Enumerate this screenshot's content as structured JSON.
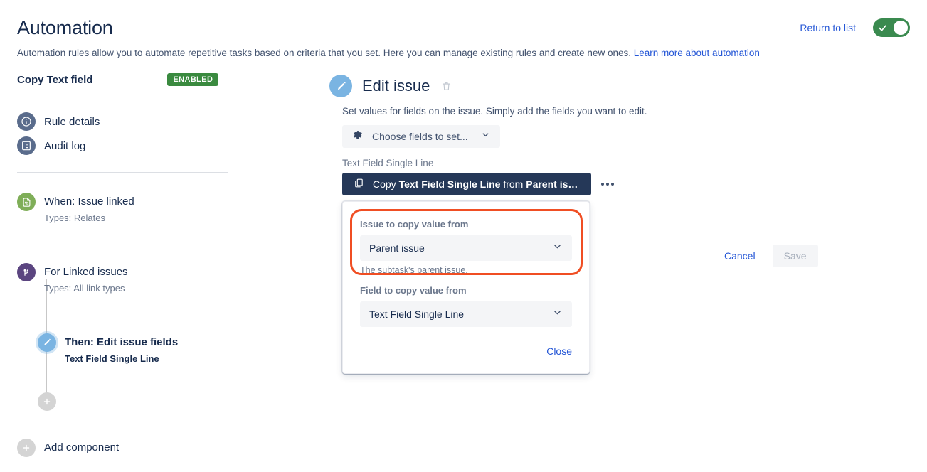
{
  "header": {
    "title": "Automation",
    "return_link": "Return to list",
    "toggle_state_icon": "check-icon",
    "toggle_color": "#3a8a4f",
    "description_prefix": "Automation rules allow you to automate repetitive tasks based on criteria that you set. Here you can manage existing rules and create new ones. ",
    "learn_more_link": "Learn more about automation"
  },
  "sidebar": {
    "rule_name": "Copy Text field",
    "status_badge": "ENABLED",
    "status_badge_color": "#3a8a3f",
    "nav_items": [
      {
        "label": "Rule details",
        "icon": "info-circle-icon"
      },
      {
        "label": "Audit log",
        "icon": "list-document-icon"
      }
    ],
    "tree": {
      "when": {
        "title": "When: Issue linked",
        "subtitle": "Types: Relates",
        "icon": "issue-linked-icon",
        "color": "#7fae58"
      },
      "for": {
        "title": "For Linked issues",
        "subtitle": "Types: All link types",
        "icon": "branch-icon",
        "color": "#5b4580"
      },
      "then": {
        "title": "Then: Edit issue fields",
        "subtitle": "Text Field Single Line",
        "icon": "pencil-icon",
        "color": "#7ab4e2"
      },
      "add_inner": {
        "icon": "plus-icon"
      },
      "add_component": {
        "label": "Add component",
        "icon": "plus-icon"
      }
    }
  },
  "main": {
    "icon": "pencil-icon",
    "title": "Edit issue",
    "delete_icon": "trash-icon",
    "description": "Set values for fields on the issue. Simply add the fields you want to edit.",
    "choose_fields": {
      "icon": "gear-icon",
      "label": "Choose fields to set...",
      "chevron": "chevron-down-icon"
    },
    "field_label": "Text Field Single Line",
    "copy_chip": {
      "icon": "copy-icon",
      "text_prefix": "Copy ",
      "text_bold_1": "Text Field Single Line",
      "text_mid": " from ",
      "text_bold_2": "Parent is…"
    },
    "more_menu": "more-options-icon"
  },
  "popup": {
    "highlighted": true,
    "highlight_color": "#f04e23",
    "issue_field": {
      "label": "Issue to copy value from",
      "value": "Parent issue",
      "help": "The subtask's parent issue.",
      "chevron": "chevron-down-icon"
    },
    "field_field": {
      "label": "Field to copy value from",
      "value": "Text Field Single Line",
      "chevron": "chevron-down-icon"
    },
    "close_label": "Close"
  },
  "actions": {
    "cancel_label": "Cancel",
    "save_label": "Save",
    "save_disabled": true
  }
}
